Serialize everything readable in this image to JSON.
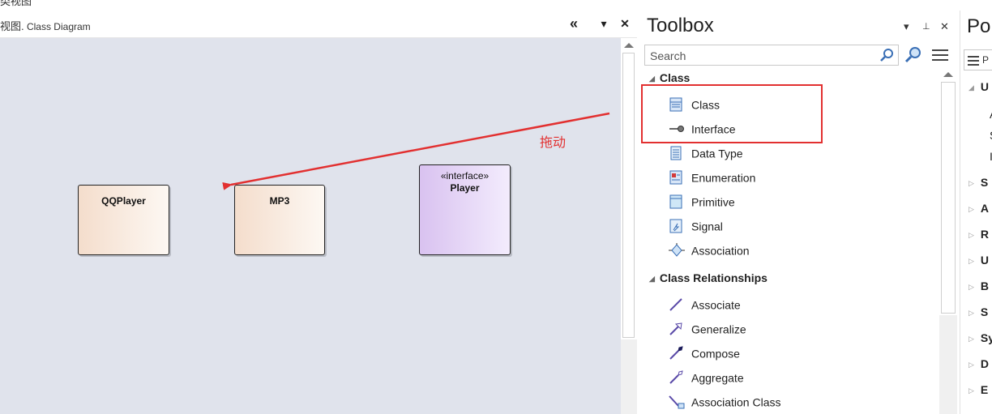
{
  "top_strip": {
    "cut_text": "类视图"
  },
  "diagram": {
    "title_prefix": "视图.",
    "title": "Class Diagram",
    "buttons": {
      "collapse": "«",
      "dropdown": "▾",
      "close": "✕"
    },
    "classes": [
      {
        "name": "QQPlayer",
        "stereotype": ""
      },
      {
        "name": "MP3",
        "stereotype": ""
      },
      {
        "name": "Player",
        "stereotype": "«interface»"
      }
    ],
    "drag_annotation": "拖动"
  },
  "toolbox": {
    "title": "Toolbox",
    "controls": {
      "dropdown": "▾",
      "pin": "⊥",
      "close": "✕"
    },
    "search_placeholder": "Search",
    "groups": [
      {
        "label": "Class",
        "items": [
          "Class",
          "Interface",
          "Data Type",
          "Enumeration",
          "Primitive",
          "Signal",
          "Association"
        ]
      },
      {
        "label": "Class Relationships",
        "items": [
          "Associate",
          "Generalize",
          "Compose",
          "Aggregate",
          "Association Class"
        ]
      }
    ],
    "icons": {
      "Class": "class-icon",
      "Interface": "interface-icon",
      "Data Type": "datatype-icon",
      "Enumeration": "enumeration-icon",
      "Primitive": "primitive-icon",
      "Signal": "signal-icon",
      "Association": "association-icon",
      "Associate": "associate-icon",
      "Generalize": "generalize-icon",
      "Compose": "compose-icon",
      "Aggregate": "aggregate-icon",
      "Association Class": "association-class-icon"
    }
  },
  "properties": {
    "title": "Po",
    "search_text": "P",
    "rows": [
      "U",
      "A",
      "S",
      "I",
      "S",
      "A",
      "R",
      "U",
      "B",
      "S",
      "Sy",
      "D",
      "E"
    ]
  },
  "colors": {
    "annotation": "#e23030",
    "canvas": "#e0e3ec"
  }
}
